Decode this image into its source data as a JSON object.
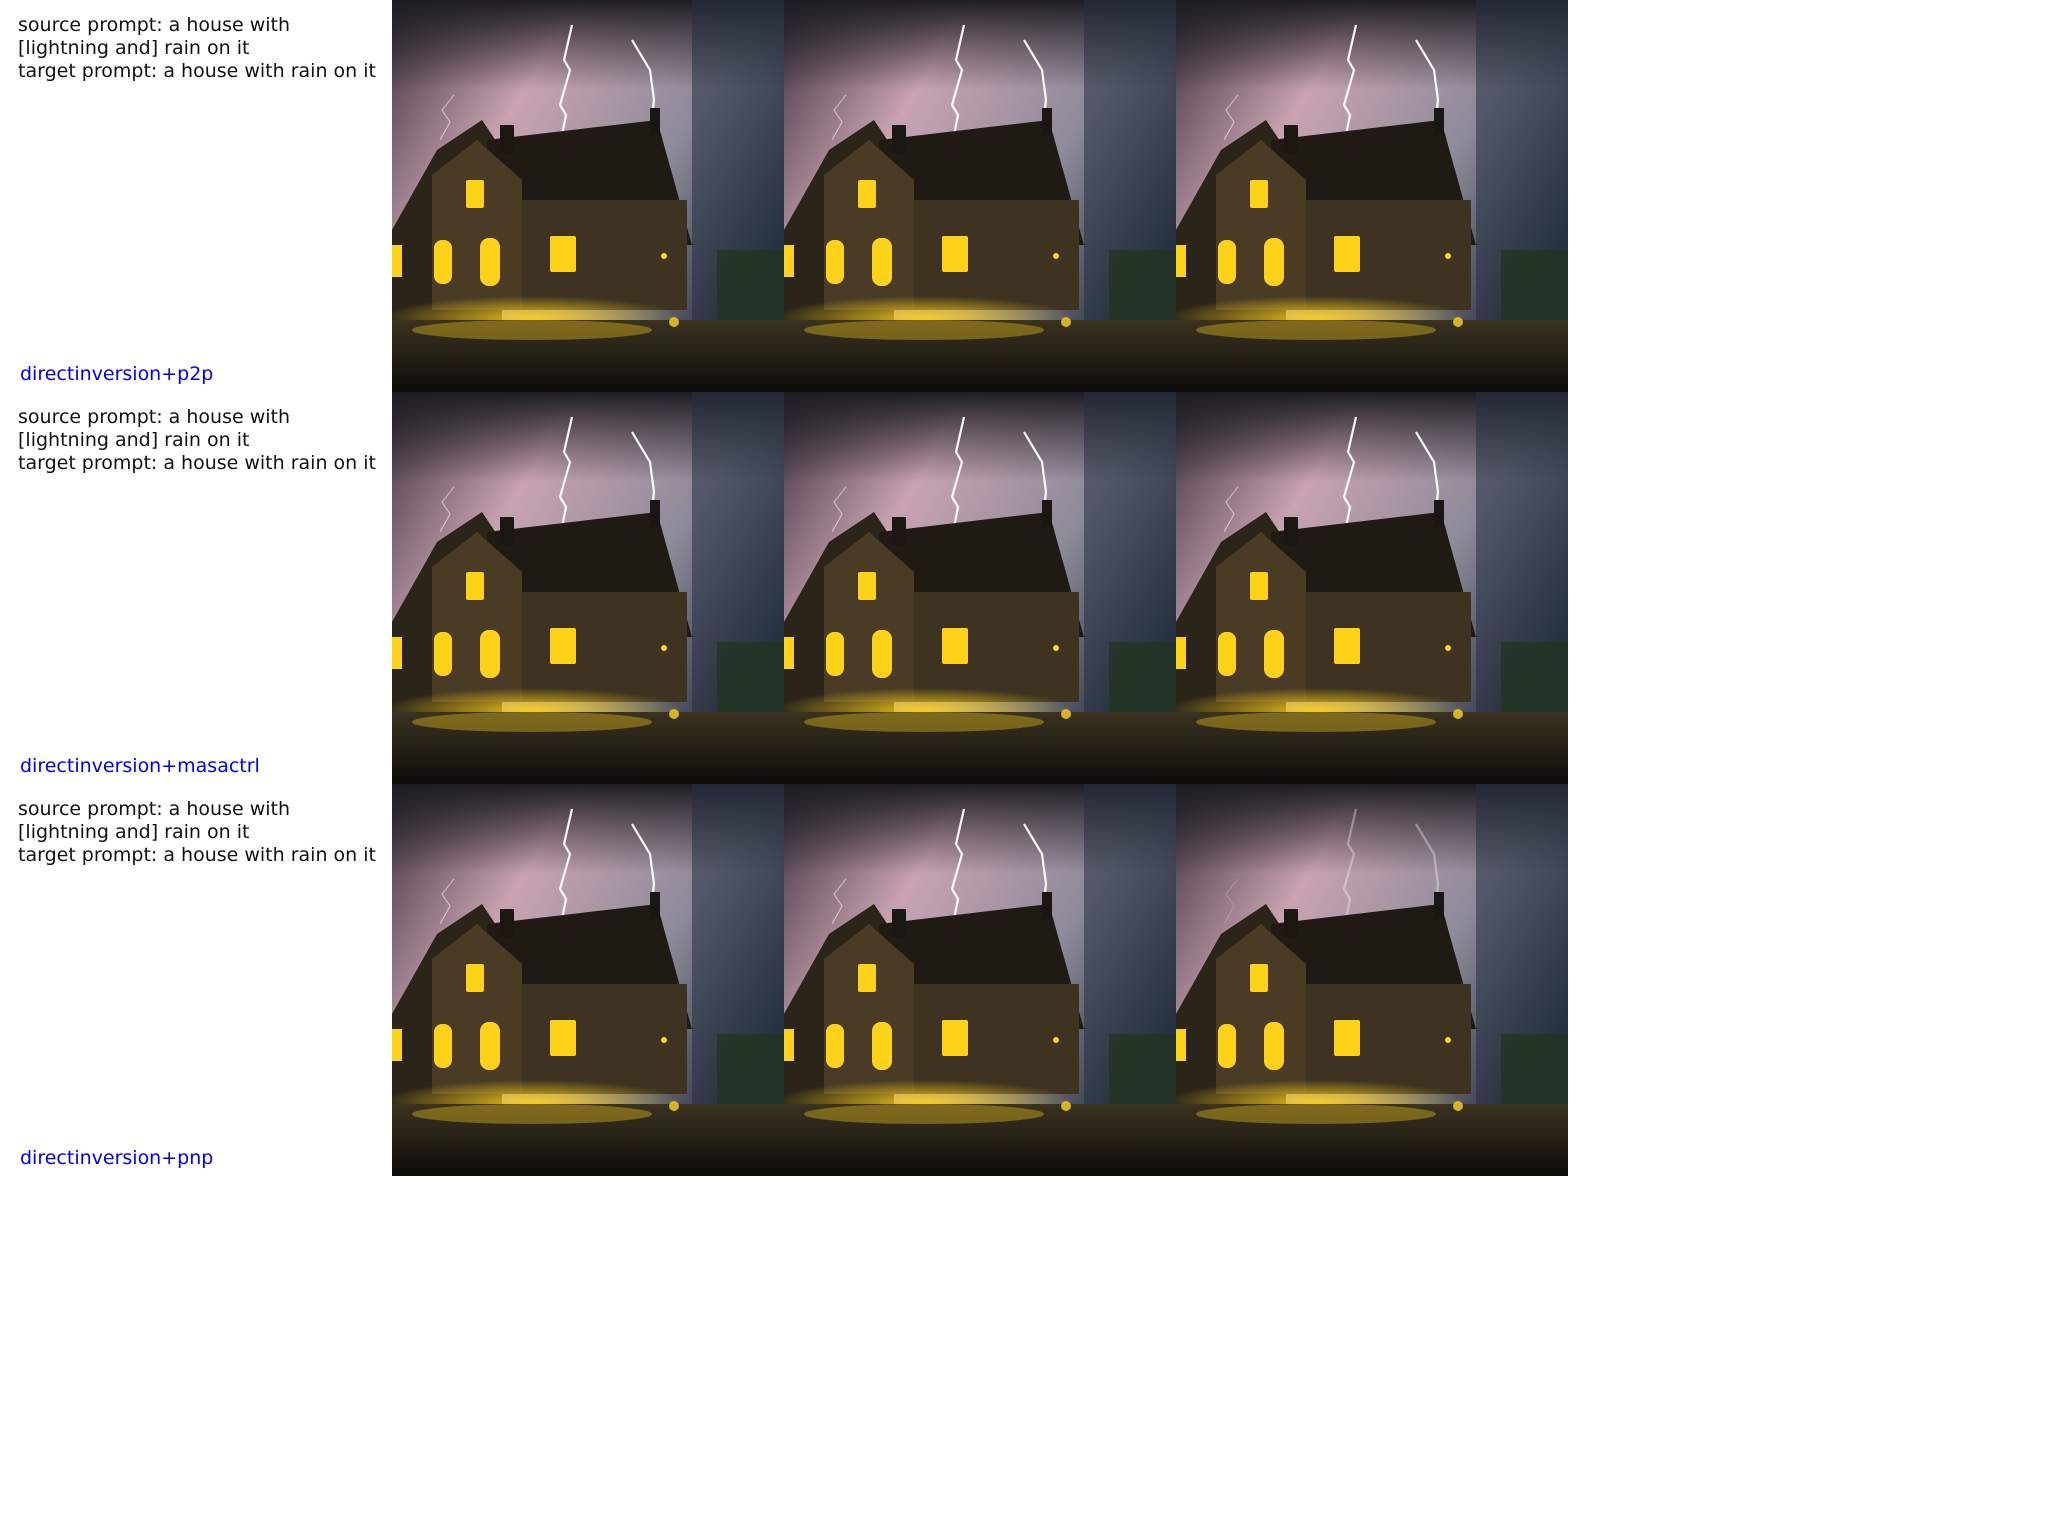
{
  "rows": [
    {
      "prompt": "source prompt: a house with\n[lightning and] rain on it\ntarget prompt: a house with rain on it",
      "method": "directinversion+p2p",
      "panels": [
        {
          "name": "source-image",
          "lightning": "strong"
        },
        {
          "name": "edited-image-1",
          "lightning": "strong"
        },
        {
          "name": "edited-image-2",
          "lightning": "strong"
        }
      ]
    },
    {
      "prompt": "source prompt: a house with\n[lightning and] rain on it\ntarget prompt: a house with rain on it",
      "method": "directinversion+masactrl",
      "panels": [
        {
          "name": "source-image",
          "lightning": "strong"
        },
        {
          "name": "edited-image-1",
          "lightning": "strong"
        },
        {
          "name": "edited-image-2",
          "lightning": "strong"
        }
      ]
    },
    {
      "prompt": "source prompt: a house with\n[lightning and] rain on it\ntarget prompt: a house with rain on it",
      "method": "directinversion+pnp",
      "panels": [
        {
          "name": "source-image",
          "lightning": "strong"
        },
        {
          "name": "edited-image-1",
          "lightning": "strong"
        },
        {
          "name": "edited-image-2",
          "lightning": "faint"
        }
      ]
    }
  ],
  "colors": {
    "method_label": "#0000ee",
    "prompt_text": "#111111",
    "window_glow": "#ffd21a"
  }
}
